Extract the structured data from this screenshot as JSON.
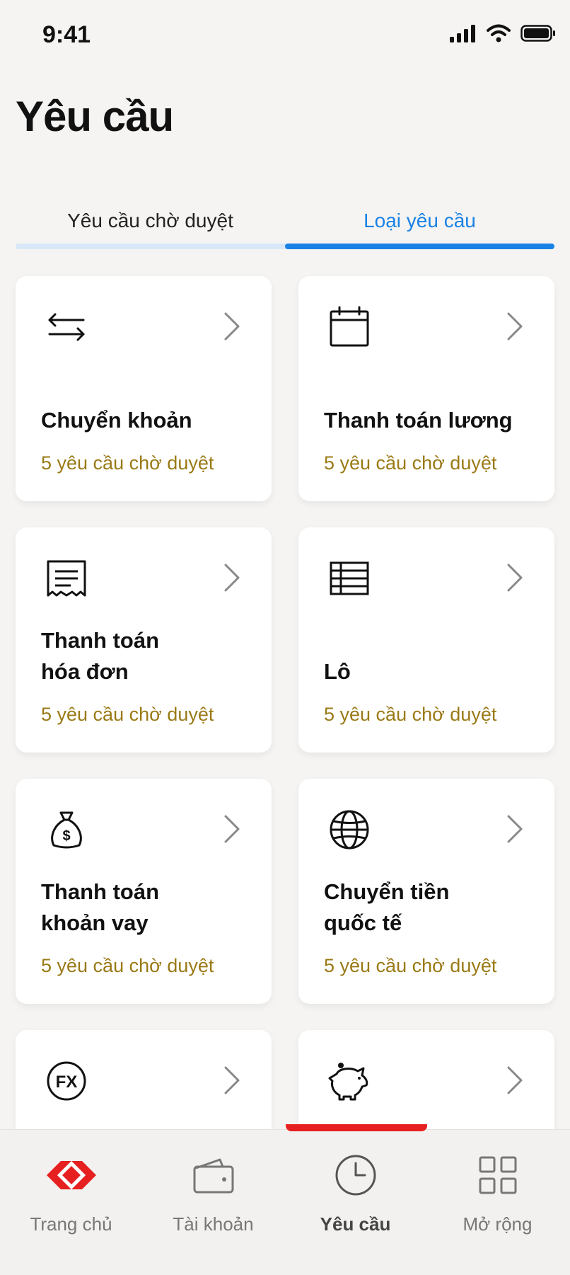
{
  "status_bar": {
    "time": "9:41"
  },
  "page_title": "Yêu cầu",
  "tabs": [
    {
      "label": "Yêu cầu chờ duyệt",
      "active": false
    },
    {
      "label": "Loại yêu cầu",
      "active": true
    }
  ],
  "cards": [
    {
      "icon": "transfer-arrows-icon",
      "title": "Chuyển khoản",
      "subtitle": "5 yêu cầu chờ duyệt"
    },
    {
      "icon": "calendar-icon",
      "title": "Thanh toán lương",
      "subtitle": "5 yêu cầu chờ duyệt"
    },
    {
      "icon": "receipt-icon",
      "title_line1": "Thanh toán",
      "title_line2": "hóa đơn",
      "subtitle": "5 yêu cầu chờ duyệt"
    },
    {
      "icon": "table-icon",
      "title": "Lô",
      "subtitle": "5 yêu cầu chờ duyệt"
    },
    {
      "icon": "money-bag-icon",
      "title_line1": "Thanh toán",
      "title_line2": "khoản vay",
      "subtitle": "5 yêu cầu chờ duyệt"
    },
    {
      "icon": "globe-icon",
      "title_line1": "Chuyển tiền",
      "title_line2": "quốc tế",
      "subtitle": "5 yêu cầu chờ duyệt"
    },
    {
      "icon": "fx-icon"
    },
    {
      "icon": "piggy-bank-icon"
    }
  ],
  "bottom_nav": [
    {
      "label": "Trang chủ",
      "icon": "home-logo-icon",
      "active": false
    },
    {
      "label": "Tài khoản",
      "icon": "wallet-icon",
      "active": false
    },
    {
      "label": "Yêu cầu",
      "icon": "clock-icon",
      "active": true
    },
    {
      "label": "Mở rộng",
      "icon": "grid-icon",
      "active": false
    }
  ],
  "colors": {
    "accent_blue": "#1a82e6",
    "subtitle_gold": "#9a7a16",
    "nav_red": "#e62020",
    "background": "#f5f4f2"
  }
}
